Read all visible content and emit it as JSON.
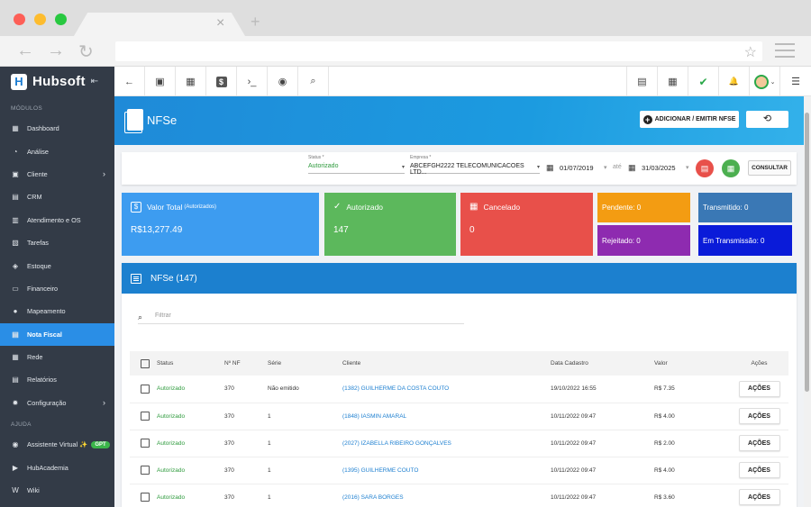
{
  "browser": {
    "tab_close": "×",
    "tab_new": "+"
  },
  "sidebar": {
    "brand": "Hubsoft",
    "collapse_icon": "⇤",
    "section_modules": "MÓDULOS",
    "items": [
      {
        "label": "Dashboard",
        "icon": "▦"
      },
      {
        "label": "Análise",
        "icon": "◔"
      },
      {
        "label": "Cliente",
        "icon": "▣",
        "chevron": "›"
      },
      {
        "label": "CRM",
        "icon": "▤"
      },
      {
        "label": "Atendimento e OS",
        "icon": "▥"
      },
      {
        "label": "Tarefas",
        "icon": "▧"
      },
      {
        "label": "Estoque",
        "icon": "◈"
      },
      {
        "label": "Financeiro",
        "icon": "▭"
      },
      {
        "label": "Mapeamento",
        "icon": "●"
      },
      {
        "label": "Nota Fiscal",
        "icon": "▤",
        "active": true
      },
      {
        "label": "Rede",
        "icon": "▦"
      },
      {
        "label": "Relatórios",
        "icon": "▤"
      },
      {
        "label": "Configuração",
        "icon": "✹",
        "chevron": "›"
      }
    ],
    "section_help": "AJUDA",
    "help_items": [
      {
        "label": "Assistente Virtual ✨",
        "icon": "◉",
        "badge": "GPT"
      },
      {
        "label": "HubAcademia",
        "icon": "▶"
      },
      {
        "label": "Wiki",
        "icon": "W"
      }
    ]
  },
  "toolbar": {
    "back": "←",
    "person": "▣",
    "calendar": "▦",
    "money": "$",
    "terminal": "›_",
    "eye": "◉",
    "search": "⌕",
    "pdf": "▤",
    "calc": "▦",
    "check": "✔",
    "bell": "🔔",
    "avatar_caret": "⌄",
    "menu": "☰"
  },
  "header": {
    "title": "NFSe",
    "add_button": "ADICIONAR / EMITIR NFSE",
    "add_plus": "+",
    "history_icon": "⟲"
  },
  "filters": {
    "status_label": "Status *",
    "status_value": "Autorizado",
    "company_label": "Empresa *",
    "company_value": "ABCEFGH2222 TELECOMUNICACOES LTD...",
    "date_from": "01/07/2019",
    "date_sep": "até",
    "date_to": "31/03/2025",
    "caret": "▾",
    "cal_icon": "▦",
    "consult_button": "CONSULTAR"
  },
  "cards": {
    "total_title": "Valor Total",
    "total_sub": "(Autorizados)",
    "total_value": "R$13,277.49",
    "total_icon": "$",
    "authorized_title": "Autorizado",
    "authorized_value": "147",
    "authorized_icon": "✓",
    "canceled_title": "Cancelado",
    "canceled_value": "0",
    "canceled_icon": "▦",
    "pending": "Pendente: 0",
    "rejected": "Rejeitado: 0",
    "transmitted": "Transmitido: 0",
    "in_transmission": "Em Transmissão: 0"
  },
  "list": {
    "title": "NFSe (147)",
    "search_icon": "⌕",
    "search_placeholder": "Filtrar",
    "columns": [
      "Status",
      "Nº NF",
      "Série",
      "Cliente",
      "Data Cadastro",
      "Valor",
      "Ações"
    ],
    "rows": [
      {
        "status": "Autorizado",
        "nf": "370",
        "serie": "Não emitido",
        "cliente": "(1382) GUILHERME DA COSTA COUTO",
        "data": "19/10/2022 16:55",
        "valor": "R$ 7.35",
        "acao": "AÇÕES"
      },
      {
        "status": "Autorizado",
        "nf": "370",
        "serie": "1",
        "cliente": "(1848) IASMIN AMARAL",
        "data": "10/11/2022 09:47",
        "valor": "R$ 4.00",
        "acao": "AÇÕES"
      },
      {
        "status": "Autorizado",
        "nf": "370",
        "serie": "1",
        "cliente": "(2027) IZABELLA RIBEIRO GONÇALVES",
        "data": "10/11/2022 09:47",
        "valor": "R$ 2.00",
        "acao": "AÇÕES"
      },
      {
        "status": "Autorizado",
        "nf": "370",
        "serie": "1",
        "cliente": "(1395) GUILHERME COUTO",
        "data": "10/11/2022 09:47",
        "valor": "R$ 4.00",
        "acao": "AÇÕES"
      },
      {
        "status": "Autorizado",
        "nf": "370",
        "serie": "1",
        "cliente": "(2016) SARA BORGES",
        "data": "10/11/2022 09:47",
        "valor": "R$ 3.60",
        "acao": "AÇÕES"
      }
    ]
  },
  "colors": {
    "sidebar_bg": "#333b47",
    "active": "#2a8ee6",
    "card_blue": "#3d9cf0",
    "card_green": "#5cb85c",
    "card_red": "#e8504a",
    "card_orange": "#f39c12",
    "card_purple": "#8e2bb0",
    "card_steel": "#3a78b5",
    "card_navy": "#0a1bd9"
  }
}
